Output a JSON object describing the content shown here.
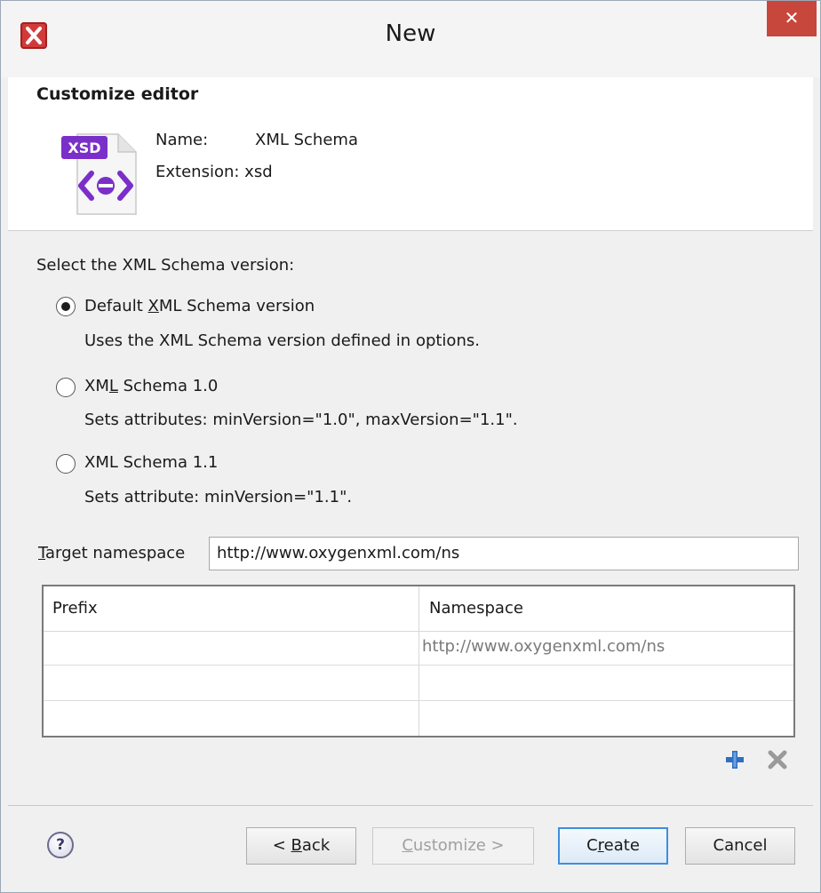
{
  "window": {
    "title": "New",
    "close_symbol": "✕"
  },
  "header": {
    "title": "Customize editor",
    "icon_badge": "XSD",
    "name_label": "Name:",
    "name_value": "XML Schema",
    "extension_label": "Extension:",
    "extension_value": "xsd"
  },
  "version": {
    "prompt": "Select the XML Schema version:",
    "options": [
      {
        "label_pre": "Default ",
        "label_mnemonic": "X",
        "label_post": "ML Schema version",
        "description": "Uses the XML Schema version defined in options.",
        "selected": true
      },
      {
        "label_pre": "XM",
        "label_mnemonic": "L",
        "label_post": " Schema 1.0",
        "description": "Sets attributes: minVersion=\"1.0\", maxVersion=\"1.1\".",
        "selected": false
      },
      {
        "label_pre": "XML Schema 1.1",
        "label_mnemonic": "",
        "label_post": "",
        "description": "Sets attribute: minVersion=\"1.1\".",
        "selected": false
      }
    ]
  },
  "namespace": {
    "label_mnemonic": "T",
    "label_rest": "arget namespace",
    "value": "http://www.oxygenxml.com/ns"
  },
  "table": {
    "columns": [
      "Prefix",
      "Namespace"
    ],
    "rows": [
      [
        "",
        "http://www.oxygenxml.com/ns"
      ],
      [
        "",
        ""
      ],
      [
        "",
        ""
      ]
    ]
  },
  "footer": {
    "help_symbol": "?",
    "back_pre": "< ",
    "back_mnemonic": "B",
    "back_post": "ack",
    "customize_mnemonic": "C",
    "customize_post": "ustomize >",
    "create_pre": "C",
    "create_mnemonic": "r",
    "create_post": "eate",
    "cancel_label": "Cancel"
  },
  "icons": {
    "app": "oxygen-logo-icon",
    "file": "xsd-file-icon",
    "add": "plus-icon",
    "remove": "delete-icon",
    "help": "help-icon"
  },
  "colors": {
    "close_button": "#c7473c",
    "xsd_badge": "#7b2fc9",
    "default_button_border": "#3d8ee0",
    "plus_icon": "#2f6fbf"
  }
}
